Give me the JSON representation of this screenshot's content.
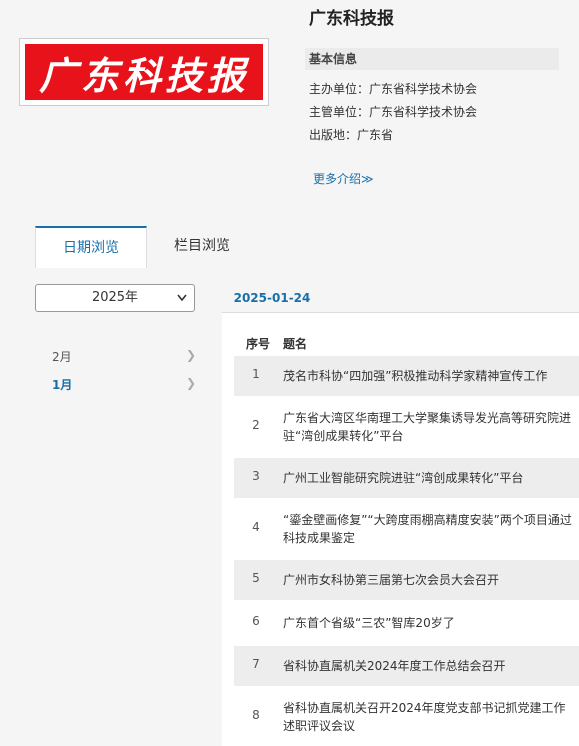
{
  "magazine": {
    "title": "广东科技报",
    "logo_text": "广东科技报",
    "info_heading": "基本信息",
    "sponsor_label": "主办单位：",
    "sponsor": "广东省科学技术协会",
    "supervisor_label": "主管单位：",
    "supervisor": "广东省科学技术协会",
    "location_label": "出版地：",
    "location": "广东省",
    "more_link": "更多介绍≫"
  },
  "tabs": {
    "date_browse": "日期浏览",
    "column_browse": "栏目浏览"
  },
  "filter": {
    "year": "2025年",
    "months": [
      {
        "label": "2月",
        "selected": false
      },
      {
        "label": "1月",
        "selected": true
      }
    ],
    "date_tab": "2025-01-24"
  },
  "table": {
    "col_no": "序号",
    "col_title": "题名",
    "rows": [
      {
        "no": "1",
        "title": "茂名市科协“四加强”积极推动科学家精神宣传工作"
      },
      {
        "no": "2",
        "title": "广东省大湾区华南理工大学聚集诱导发光高等研究院进驻“湾创成果转化”平台"
      },
      {
        "no": "3",
        "title": "广州工业智能研究院进驻“湾创成果转化”平台"
      },
      {
        "no": "4",
        "title": "“鎏金壁画修复”“大跨度雨棚高精度安装”两个项目通过科技成果鉴定"
      },
      {
        "no": "5",
        "title": "广州市女科协第三届第七次会员大会召开"
      },
      {
        "no": "6",
        "title": "广东首个省级“三农”智库20岁了"
      },
      {
        "no": "7",
        "title": "省科协直属机关2024年度工作总结会召开"
      },
      {
        "no": "8",
        "title": "省科协直属机关召开2024年度党支部书记抓党建工作述职评议会议"
      }
    ]
  },
  "colors": {
    "accent": "#1a6fa8",
    "logo_red": "#e8121b",
    "row_shade": "#ededed"
  }
}
